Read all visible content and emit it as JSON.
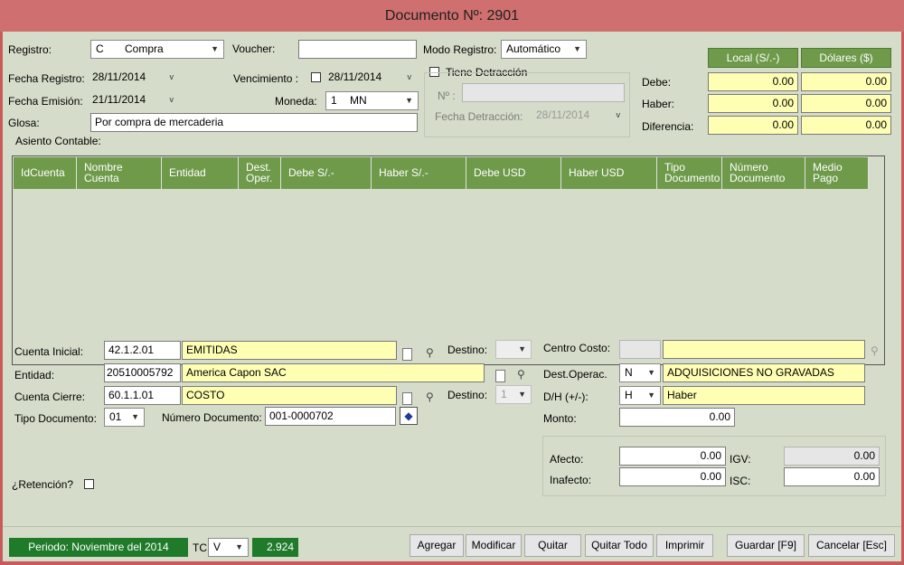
{
  "window": {
    "title": "Documento Nº: 2901"
  },
  "header": {
    "registro_label": "Registro:",
    "registro_code": "C",
    "registro_value": "Compra",
    "voucher_label": "Voucher:",
    "voucher_value": "",
    "modo_registro_label": "Modo Registro:",
    "modo_registro_value": "Automático",
    "fecha_registro_label": "Fecha Registro:",
    "fecha_registro_value": "28/11/2014",
    "vencimiento_label": "Vencimiento  :",
    "vencimiento_value": "28/11/2014",
    "tiene_detraccion_label": "Tiene Detracción",
    "fecha_emision_label": "Fecha Emisión:",
    "fecha_emision_value": "21/11/2014",
    "moneda_label": "Moneda:",
    "moneda_code": "1",
    "moneda_value": "MN",
    "nro_label": "Nº :",
    "nro_value": "",
    "fecha_detraccion_label": "Fecha Detracción:",
    "fecha_detraccion_value": "28/11/2014",
    "glosa_label": "Glosa:",
    "glosa_value": "Por compra de mercaderia",
    "asiento_label": "Asiento Contable:"
  },
  "totals": {
    "local_header": "Local (S/.-)",
    "dolares_header": "Dólares ($)",
    "rows": [
      {
        "label": "Debe:",
        "local": "0.00",
        "dolares": "0.00"
      },
      {
        "label": "Haber:",
        "local": "0.00",
        "dolares": "0.00"
      },
      {
        "label": "Diferencia:",
        "local": "0.00",
        "dolares": "0.00"
      }
    ]
  },
  "grid": {
    "columns": [
      {
        "line1": "IdCuenta",
        "line2": ""
      },
      {
        "line1": "Nombre",
        "line2": "Cuenta"
      },
      {
        "line1": "Entidad",
        "line2": ""
      },
      {
        "line1": "Dest.",
        "line2": "Oper."
      },
      {
        "line1": "Debe S/.-",
        "line2": ""
      },
      {
        "line1": "Haber S/.-",
        "line2": ""
      },
      {
        "line1": "Debe USD",
        "line2": ""
      },
      {
        "line1": "Haber USD",
        "line2": ""
      },
      {
        "line1": "Tipo",
        "line2": "Documento"
      },
      {
        "line1": "Número",
        "line2": "Documento"
      },
      {
        "line1": "Medio",
        "line2": "Pago"
      }
    ]
  },
  "detail": {
    "cuenta_inicial_label": "Cuenta Inicial:",
    "cuenta_inicial_code": "42.1.2.01",
    "cuenta_inicial_name": "EMITIDAS",
    "destino_label": "Destino:",
    "destino_value": "",
    "centro_costo_label": "Centro Costo:",
    "centro_costo_code": "",
    "centro_costo_name": "",
    "entidad_label": "Entidad:",
    "entidad_code": "20510005792",
    "entidad_name": "America Capon SAC",
    "dest_operac_label": "Dest.Operac.",
    "dest_operac_code": "N",
    "dest_operac_name": "ADQUISICIONES NO GRAVADAS",
    "cuenta_cierre_label": "Cuenta Cierre:",
    "cuenta_cierre_code": "60.1.1.01",
    "cuenta_cierre_name": "COSTO",
    "destino2_label": "Destino:",
    "destino2_value": "1",
    "dh_label": "D/H (+/-):",
    "dh_code": "H",
    "dh_name": "Haber",
    "tipo_documento_label": "Tipo Documento:",
    "tipo_documento_value": "01",
    "numero_documento_label": "Número Documento:",
    "numero_documento_value": "001-0000702",
    "monto_label": "Monto:",
    "monto_value": "0.00",
    "afecto_label": "Afecto:",
    "afecto_value": "0.00",
    "igv_label": "IGV:",
    "igv_value": "0.00",
    "inafecto_label": "Inafecto:",
    "inafecto_value": "0.00",
    "isc_label": "ISC:",
    "isc_value": "0.00",
    "retencion_label": "¿Retención?"
  },
  "footer": {
    "periodo": "Periodo: Noviembre del 2014",
    "tc_label": "TC:",
    "tc_code": "V",
    "tc_value": "2.924",
    "buttons": {
      "agregar": "Agregar",
      "modificar": "Modificar",
      "quitar": "Quitar",
      "quitar_todo": "Quitar Todo",
      "imprimir": "Imprimir",
      "guardar": "Guardar [F9]",
      "cancelar": "Cancelar [Esc]"
    }
  },
  "colors": {
    "title_bar": "#cf6f6f",
    "panel": "#d5dcc9",
    "header_green": "#6e9a4a",
    "yellow_field": "#ffffb4",
    "footer_green": "#1f7a2a"
  }
}
